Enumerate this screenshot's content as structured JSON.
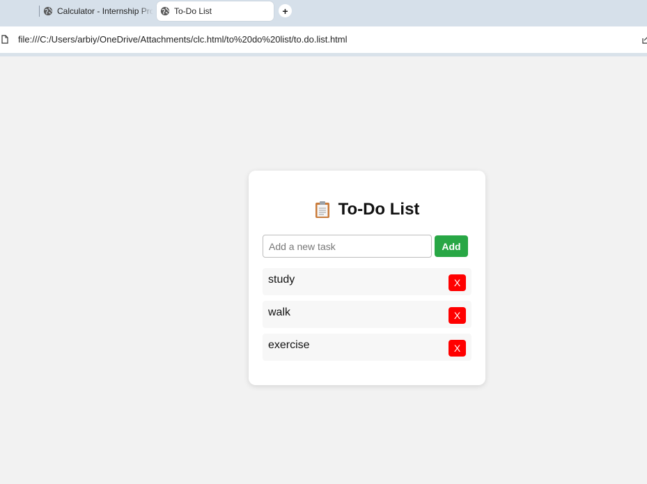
{
  "browser": {
    "tabs": [
      {
        "title": "Calculator - Internship Pro",
        "active": false
      },
      {
        "title": "To-Do List",
        "active": true
      }
    ],
    "new_tab_label": "+",
    "url": "file:///C:/Users/arbiy/OneDrive/Attachments/clc.html/to%20do%20list/to.do.list.html"
  },
  "app": {
    "title": "To-Do List",
    "title_icon": "clipboard-icon",
    "input": {
      "placeholder": "Add a new task",
      "value": ""
    },
    "add_label": "Add",
    "delete_label": "X",
    "tasks": [
      {
        "text": "study"
      },
      {
        "text": "walk"
      },
      {
        "text": "exercise"
      }
    ]
  },
  "colors": {
    "add_button": "#28a745",
    "delete_button": "#ff0000",
    "page_background": "#f2f2f2",
    "tab_strip": "#d6e0ea"
  }
}
